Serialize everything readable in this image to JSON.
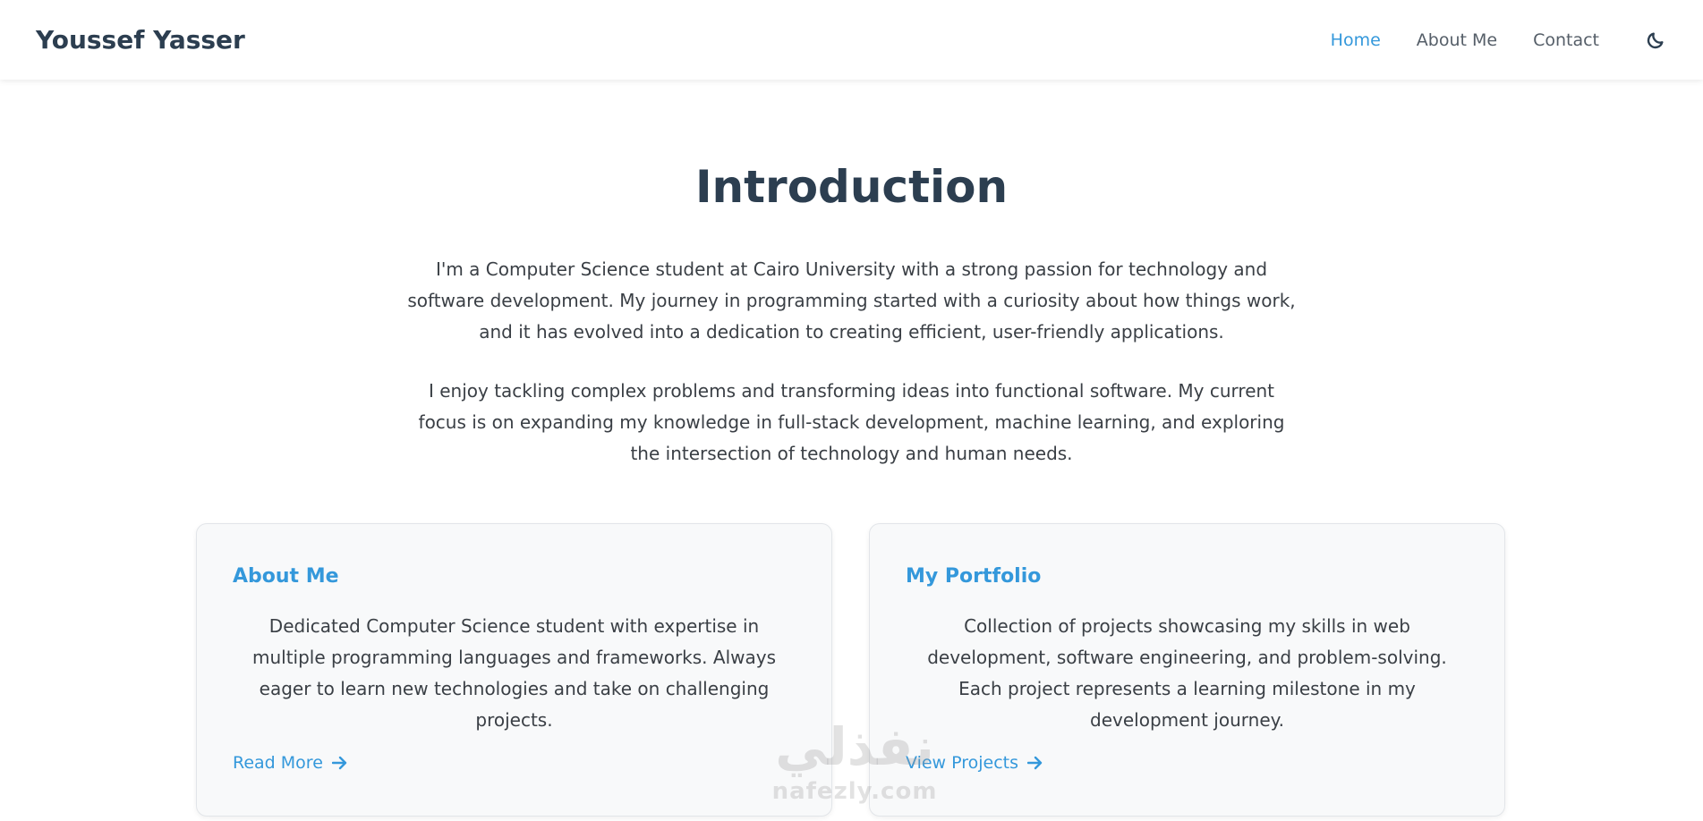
{
  "header": {
    "brand": "Youssef Yasser",
    "nav": [
      {
        "label": "Home",
        "active": true
      },
      {
        "label": "About Me",
        "active": false
      },
      {
        "label": "Contact",
        "active": false
      }
    ],
    "theme_toggle_icon": "moon-icon"
  },
  "intro": {
    "title": "Introduction",
    "paragraph1": "I'm a Computer Science student at Cairo University with a strong passion for technology and software development. My journey in programming started with a curiosity about how things work, and it has evolved into a dedication to creating efficient, user-friendly applications.",
    "paragraph2": "I enjoy tackling complex problems and transforming ideas into functional software. My current focus is on expanding my knowledge in full-stack development, machine learning, and exploring the intersection of technology and human needs."
  },
  "cards": [
    {
      "title": "About Me",
      "text": "Dedicated Computer Science student with expertise in multiple programming languages and frameworks. Always eager to learn new technologies and take on challenging projects.",
      "link_label": "Read More",
      "link_icon": "arrow-right-icon"
    },
    {
      "title": "My Portfolio",
      "text": "Collection of projects showcasing my skills in web development, software engineering, and problem-solving. Each project represents a learning milestone in my development journey.",
      "link_label": "View Projects",
      "link_icon": "arrow-right-icon"
    }
  ],
  "watermark": {
    "arabic": "نفذلي",
    "latin": "nafezly.com"
  },
  "colors": {
    "accent": "#3498db",
    "heading": "#2c3e50",
    "body_text": "#3a3f45",
    "card_bg": "#f8f9fa"
  }
}
